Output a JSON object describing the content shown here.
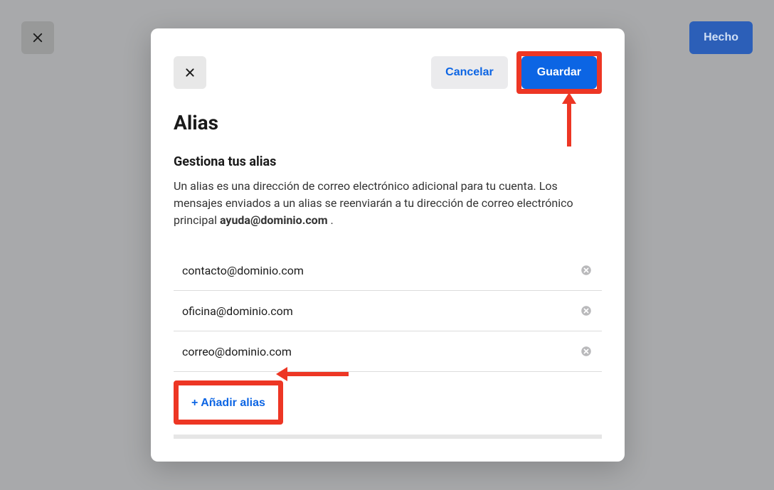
{
  "outer": {
    "done_label": "Hecho"
  },
  "modal": {
    "cancel_label": "Cancelar",
    "save_label": "Guardar",
    "title": "Alias",
    "subtitle": "Gestiona tus alias",
    "description_pre": "Un alias es una dirección de correo electrónico adicional para tu cuenta. Los mensajes enviados a un alias se reenviarán a tu dirección de correo electrónico principal ",
    "primary_email": "ayuda@dominio.com",
    "description_post": " .",
    "aliases": [
      {
        "email": "contacto@dominio.com"
      },
      {
        "email": "oficina@dominio.com"
      },
      {
        "email": "correo@dominio.com"
      }
    ],
    "add_alias_label": "+ Añadir alias"
  }
}
